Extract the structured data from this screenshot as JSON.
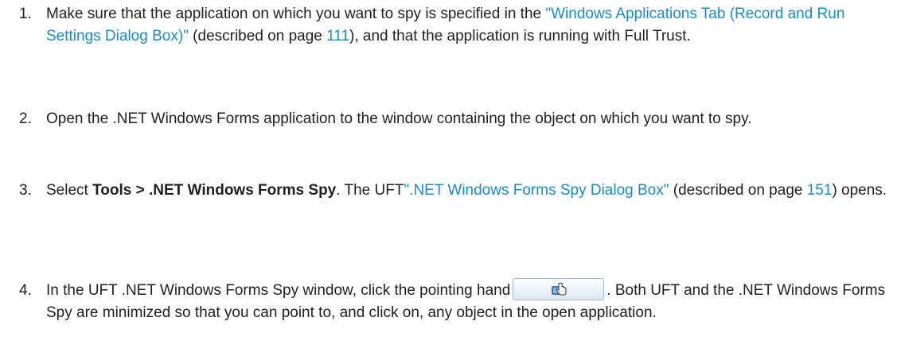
{
  "steps": [
    {
      "number": "1.",
      "text_1": "Make sure that the application on which you want to spy is specified in the ",
      "link_1": "\"Windows Applications Tab (Record and Run Settings Dialog Box)\"",
      "text_2": " (described on page ",
      "page_link": "111",
      "text_3": "), and that the application is running with Full Trust."
    },
    {
      "number": "2.",
      "text_1": "Open the .NET Windows Forms application to the window containing the object on which you want to spy."
    },
    {
      "number": "3.",
      "text_1": "Select ",
      "bold_1": "Tools > .NET Windows Forms Spy",
      "text_2": ". The UFT",
      "link_1": "\".NET Windows Forms Spy Dialog Box\"",
      "text_3": " (described on page ",
      "page_link": "151",
      "text_4": ") opens."
    },
    {
      "number": "4.",
      "text_1": "In the UFT .NET Windows Forms Spy window, click the pointing hand",
      "button_icon": "pointing-hand-icon",
      "text_2": ". Both UFT and the .NET Windows Forms Spy are minimized so that you can point to, and click on, any object in the open application."
    }
  ],
  "colors": {
    "link": "#1a8bc9",
    "text": "#1f1f1f"
  }
}
